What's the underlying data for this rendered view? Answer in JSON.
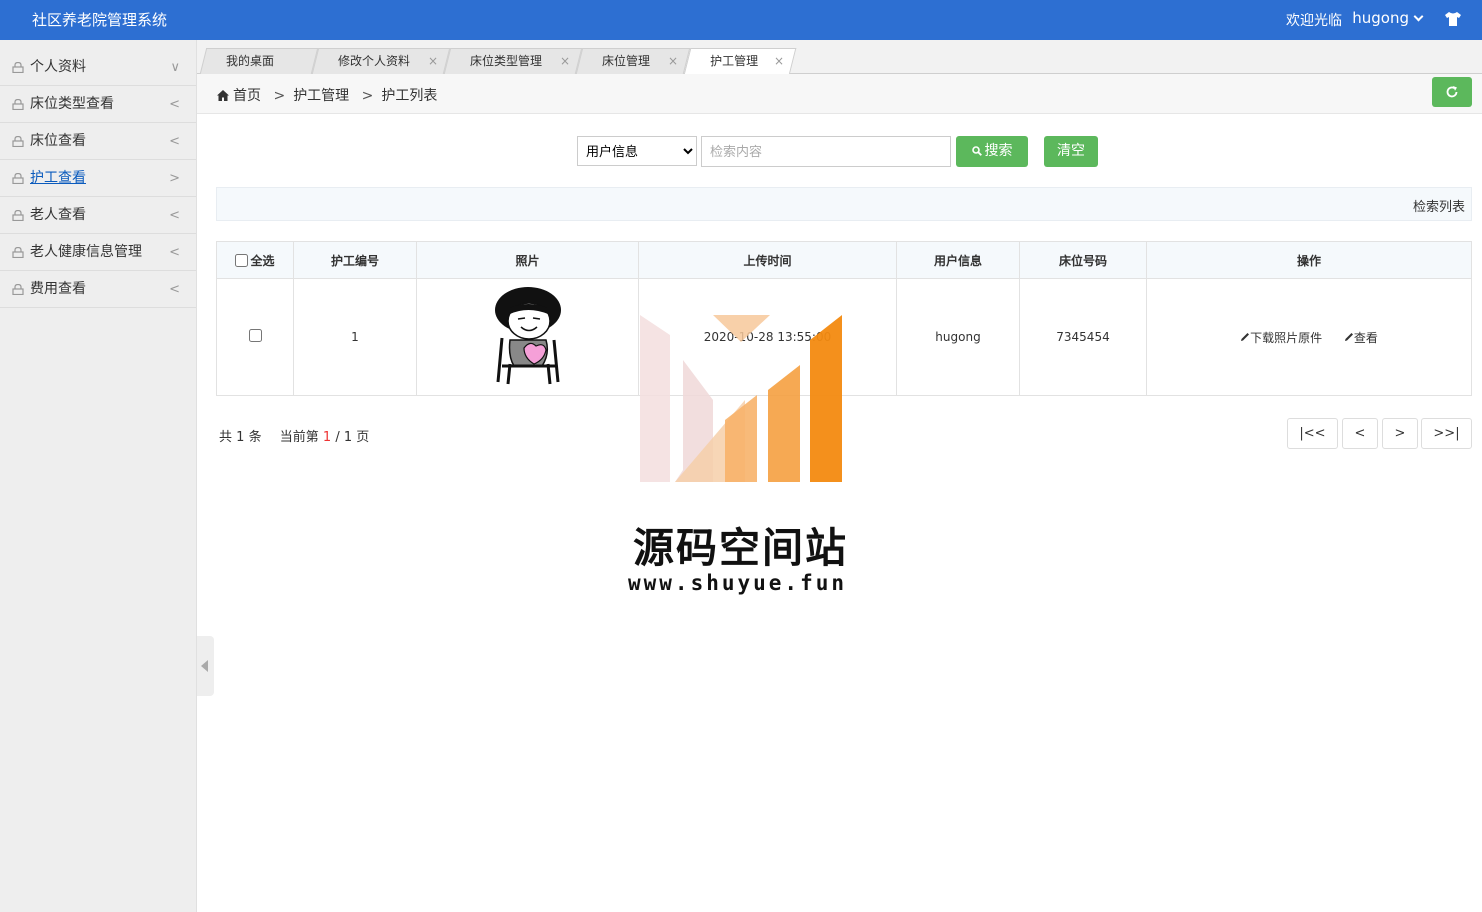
{
  "header": {
    "title": "社区养老院管理系统",
    "welcome": "欢迎光临",
    "username": "hugong"
  },
  "sidebar": {
    "items": [
      {
        "label": "个人资料",
        "arrow": "∨"
      },
      {
        "label": "床位类型查看",
        "arrow": "<"
      },
      {
        "label": "床位查看",
        "arrow": "<"
      },
      {
        "label": "护工查看",
        "arrow": ">"
      },
      {
        "label": "老人查看",
        "arrow": "<"
      },
      {
        "label": "老人健康信息管理",
        "arrow": "<"
      },
      {
        "label": "费用查看",
        "arrow": "<"
      }
    ]
  },
  "tabs": [
    {
      "label": "我的桌面"
    },
    {
      "label": "修改个人资料",
      "close": "×"
    },
    {
      "label": "床位类型管理",
      "close": "×"
    },
    {
      "label": "床位管理",
      "close": "×"
    },
    {
      "label": "护工管理",
      "close": "×"
    }
  ],
  "breadcrumb": {
    "home": "首页",
    "sep": ">",
    "level1": "护工管理",
    "level2": "护工列表"
  },
  "search": {
    "field_selected": "用户信息",
    "placeholder": "检索内容",
    "search_label": "搜索",
    "clear_label": "清空"
  },
  "list_title": "检索列表",
  "table": {
    "headers": {
      "select_all": "全选",
      "id": "护工编号",
      "photo": "照片",
      "upload_time": "上传时间",
      "user": "用户信息",
      "bed_no": "床位号码",
      "actions": "操作"
    },
    "rows": [
      {
        "id": "1",
        "upload_time": "2020-10-28 13:55:00",
        "user": "hugong",
        "bed_no": "7345454",
        "action_download": "下载照片原件",
        "action_view": "查看"
      }
    ]
  },
  "pager": {
    "total_prefix": "共",
    "total": "1",
    "total_suffix": "条",
    "current_prefix": "当前第",
    "current": "1",
    "slash": "/",
    "pages": "1",
    "pages_suffix": "页",
    "first": "|<<",
    "prev": "<",
    "next": ">",
    "last": ">>|"
  },
  "watermark": {
    "title": "源码空间站",
    "url": "www.shuyue.fun"
  },
  "colors": {
    "header_bg": "#2d6fd2",
    "button_green": "#5cb85c",
    "active_link": "#0b5bbd",
    "page_current": "#ee3333"
  }
}
